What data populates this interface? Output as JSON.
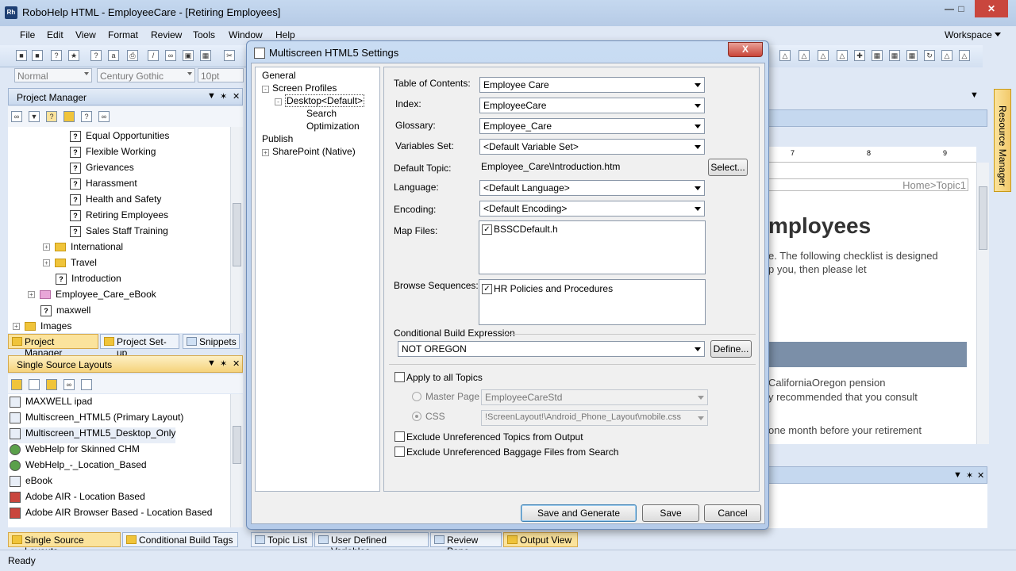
{
  "window": {
    "title": "RoboHelp HTML - EmployeeCare - [Retiring Employees]",
    "app_icon": "Rh"
  },
  "menus": [
    "File",
    "Edit",
    "View",
    "Format",
    "Review",
    "Tools",
    "Window",
    "Help"
  ],
  "workspace_label": "Workspace",
  "format_bar": {
    "style": "Normal",
    "font": "Century Gothic",
    "size": "10pt"
  },
  "project_manager": {
    "title": "Project Manager",
    "items": [
      "Equal Opportunities",
      "Flexible Working",
      "Grievances",
      "Harassment",
      "Health and Safety",
      "Retiring Employees",
      "Sales Staff Training"
    ],
    "folders": [
      "International",
      "Travel"
    ],
    "introduction": "Introduction",
    "ebook": "Employee_Care_eBook",
    "maxwell": "maxwell",
    "images": "Images"
  },
  "pm_tabs": [
    "Project Manager",
    "Project Set-up",
    "Snippets"
  ],
  "single_source": {
    "title": "Single Source Layouts",
    "layouts": [
      "MAXWELL ipad",
      "Multiscreen_HTML5 (Primary Layout)",
      "Multiscreen_HTML5_Desktop_Only",
      "WebHelp for Skinned CHM",
      "WebHelp_-_Location_Based",
      "eBook",
      "Adobe AIR - Location Based",
      "Adobe AIR Browser Based - Location Based"
    ]
  },
  "bottom_tabs": [
    "Single Source Layouts",
    "Conditional Build Tags",
    "Topic List",
    "User Defined Variables",
    "Review Pane",
    "Output View"
  ],
  "status": "Ready",
  "resource_manager": "Resource Manager",
  "doc": {
    "breadcrumb": "Home>Topic1",
    "heading": "mployees",
    "line1": "e. The following checklist is designed",
    "line2": "p you, then please let",
    "line3": "CaliforniaOregon pension",
    "line4": "y recommended that you consult",
    "line5": "one month before your retirement",
    "ruler": [
      "7",
      "8",
      "9"
    ]
  },
  "dialog": {
    "title": "Multiscreen HTML5 Settings",
    "close": "X",
    "nav": {
      "general": "General",
      "screen_profiles": "Screen Profiles",
      "desktop": "Desktop<Default>",
      "search": "Search",
      "optimization": "Optimization",
      "publish": "Publish",
      "sharepoint": "SharePoint (Native)"
    },
    "labels": {
      "toc": "Table of Contents:",
      "index": "Index:",
      "glossary": "Glossary:",
      "variables": "Variables Set:",
      "default_topic": "Default Topic:",
      "language": "Language:",
      "encoding": "Encoding:",
      "map_files": "Map Files:",
      "browse": "Browse Sequences:",
      "cbe": "Conditional Build Expression"
    },
    "values": {
      "toc": "Employee Care",
      "index": "EmployeeCare",
      "glossary": "Employee_Care",
      "variables": "<Default Variable Set>",
      "default_topic": "Employee_Care\\Introduction.htm",
      "language": "<Default Language>",
      "encoding": "<Default Encoding>",
      "map_file": "BSSCDefault.h",
      "browse_seq": "HR Policies and Procedures",
      "cbe": "NOT OREGON"
    },
    "buttons": {
      "select": "Select...",
      "define": "Define...",
      "save_generate": "Save and Generate",
      "save": "Save",
      "cancel": "Cancel"
    },
    "apply_all": "Apply to all Topics",
    "master_page_label": "Master Page",
    "master_page": "EmployeeCareStd",
    "css_label": "CSS",
    "css": "!ScreenLayout!\\Android_Phone_Layout\\mobile.css",
    "exclude_topics": "Exclude Unreferenced Topics from Output",
    "exclude_baggage": "Exclude Unreferenced Baggage Files from Search"
  }
}
